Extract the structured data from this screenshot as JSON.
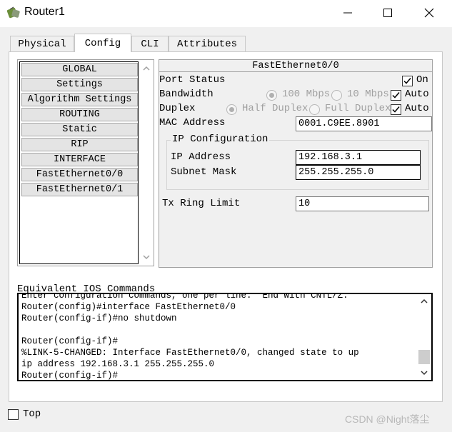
{
  "window": {
    "title": "Router1",
    "minimize_icon": "minimize-icon",
    "maximize_icon": "maximize-icon",
    "close_icon": "close-icon"
  },
  "tabs": [
    {
      "label": "Physical",
      "active": false
    },
    {
      "label": "Config",
      "active": true
    },
    {
      "label": "CLI",
      "active": false
    },
    {
      "label": "Attributes",
      "active": false
    }
  ],
  "sidebar": {
    "items": [
      {
        "label": "GLOBAL"
      },
      {
        "label": "Settings"
      },
      {
        "label": "Algorithm Settings"
      },
      {
        "label": "ROUTING"
      },
      {
        "label": "Static"
      },
      {
        "label": "RIP"
      },
      {
        "label": "INTERFACE"
      },
      {
        "label": "FastEthernet0/0"
      },
      {
        "label": "FastEthernet0/1"
      }
    ]
  },
  "interface_panel": {
    "title": "FastEthernet0/0",
    "port_status_label": "Port Status",
    "port_status_on_label": "On",
    "port_status_on": true,
    "bandwidth_label": "Bandwidth",
    "bandwidth_100": "100 Mbps",
    "bandwidth_10": "10 Mbps",
    "bandwidth_auto_label": "Auto",
    "bandwidth_auto": true,
    "duplex_label": "Duplex",
    "duplex_half": "Half Duplex",
    "duplex_full": "Full Duplex",
    "duplex_auto_label": "Auto",
    "duplex_auto": true,
    "mac_label": "MAC Address",
    "mac_value": "0001.C9EE.8901",
    "ip_config_title": "IP Configuration",
    "ip_label": "IP Address",
    "ip_value": "192.168.3.1",
    "mask_label": "Subnet Mask",
    "mask_value": "255.255.255.0",
    "tx_label": "Tx Ring Limit",
    "tx_value": "10"
  },
  "ios": {
    "label": "Equivalent IOS Commands",
    "lines": [
      "Enter configuration commands, one per line.  End with CNTL/Z.",
      "Router(config)#interface FastEthernet0/0",
      "Router(config-if)#no shutdown",
      "",
      "Router(config-if)#",
      "%LINK-5-CHANGED: Interface FastEthernet0/0, changed state to up",
      "ip address 192.168.3.1 255.255.255.0",
      "Router(config-if)#"
    ]
  },
  "footer": {
    "top_label": "Top",
    "top_checked": false,
    "watermark": "CSDN @Night落尘"
  }
}
